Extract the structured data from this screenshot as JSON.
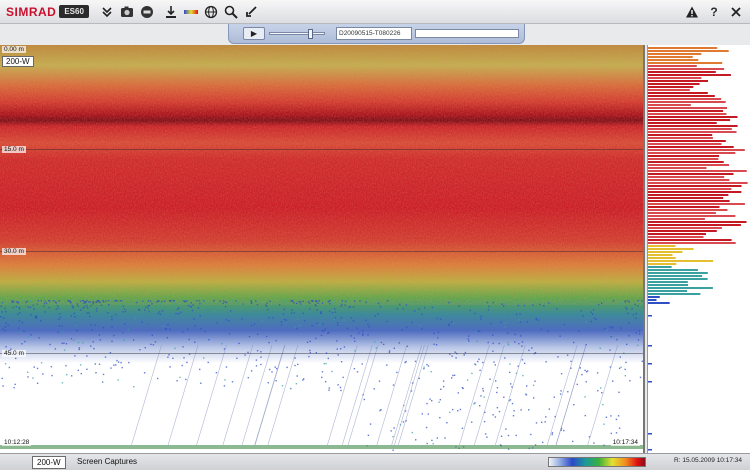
{
  "toolbar": {
    "logo": "SIMRAD",
    "model": "ES60",
    "left_icons": [
      "chevron-down-icon",
      "camera-icon",
      "record-icon",
      "download-icon",
      "color-bar-icon",
      "globe-icon",
      "magnifier-icon",
      "arrow-icon"
    ],
    "right_icons": [
      "warning-icon",
      "help-icon",
      "close-icon"
    ]
  },
  "replay": {
    "filename": "D20090515-T080226",
    "slider_value": 0.75,
    "progress": 0.0
  },
  "echogram": {
    "range_top": "0.00 m",
    "range_mode": "200-W",
    "depth_labels": [
      "15.0 m",
      "30.0 m",
      "45.0 m"
    ],
    "time_start": "10:12:28",
    "time_end": "10:17:34"
  },
  "status": {
    "range_mode": "200-W",
    "caption": "Screen Captures",
    "datetime": "R: 15.05.2009   10:17:34"
  },
  "colors": {
    "logo_red": "#c8102e",
    "echo_red": "#c41a24",
    "echo_dark_red": "#8e0f1a",
    "echo_green": "#38a838",
    "echo_blue": "#2b4bc0"
  }
}
